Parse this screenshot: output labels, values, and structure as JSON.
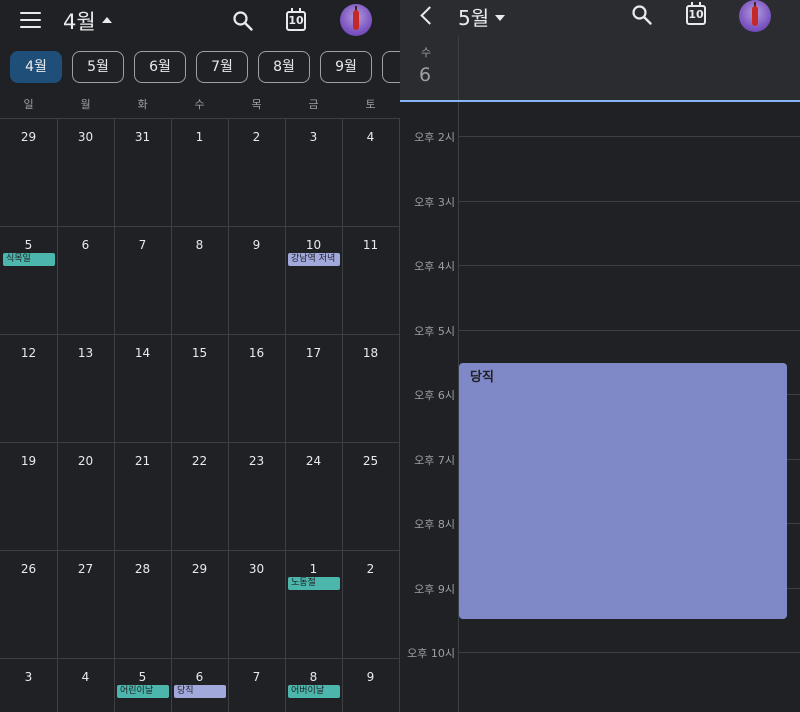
{
  "left_pane": {
    "title": "4월",
    "today_badge": "10",
    "month_chips": [
      "4월",
      "5월",
      "6월",
      "7월",
      "8월",
      "9월",
      "1"
    ],
    "active_chip_index": 0,
    "weekdays": [
      "일",
      "월",
      "화",
      "수",
      "목",
      "금",
      "토"
    ],
    "weeks": [
      [
        "29",
        "30",
        "31",
        "1",
        "2",
        "3",
        "4"
      ],
      [
        "5",
        "6",
        "7",
        "8",
        "9",
        "10",
        "11"
      ],
      [
        "12",
        "13",
        "14",
        "15",
        "16",
        "17",
        "18"
      ],
      [
        "19",
        "20",
        "21",
        "22",
        "23",
        "24",
        "25"
      ],
      [
        "26",
        "27",
        "28",
        "29",
        "30",
        "1",
        "2"
      ],
      [
        "3",
        "4",
        "5",
        "6",
        "7",
        "8",
        "9"
      ]
    ],
    "events": [
      {
        "week": 1,
        "day": 0,
        "label": "식목일",
        "color": "#4db6ac"
      },
      {
        "week": 1,
        "day": 5,
        "label": "강남역 저녁",
        "color": "#a1a8dc"
      },
      {
        "week": 4,
        "day": 5,
        "label": "노동절",
        "color": "#4db6ac"
      },
      {
        "week": 5,
        "day": 2,
        "label": "어린이날",
        "color": "#4db6ac"
      },
      {
        "week": 5,
        "day": 3,
        "label": "당직",
        "color": "#a1a8dc"
      },
      {
        "week": 5,
        "day": 5,
        "label": "어버이날",
        "color": "#4db6ac"
      }
    ]
  },
  "right_pane": {
    "title": "5월",
    "today_badge": "10",
    "day_of_week": "수",
    "date": "6",
    "time_labels": [
      "오후 2시",
      "오후 3시",
      "오후 4시",
      "오후 5시",
      "오후 6시",
      "오후 7시",
      "오후 8시",
      "오후 9시",
      "오후 10시"
    ],
    "event": {
      "label": "당직",
      "color": "#7f89c8"
    }
  },
  "colors": {
    "background": "#202124",
    "header_background": "#2b2c2f",
    "active_chip": "#1f4e79",
    "now_line": "#8ab4f8",
    "holiday_green": "#4db6ac",
    "event_purple": "#a1a8dc"
  }
}
